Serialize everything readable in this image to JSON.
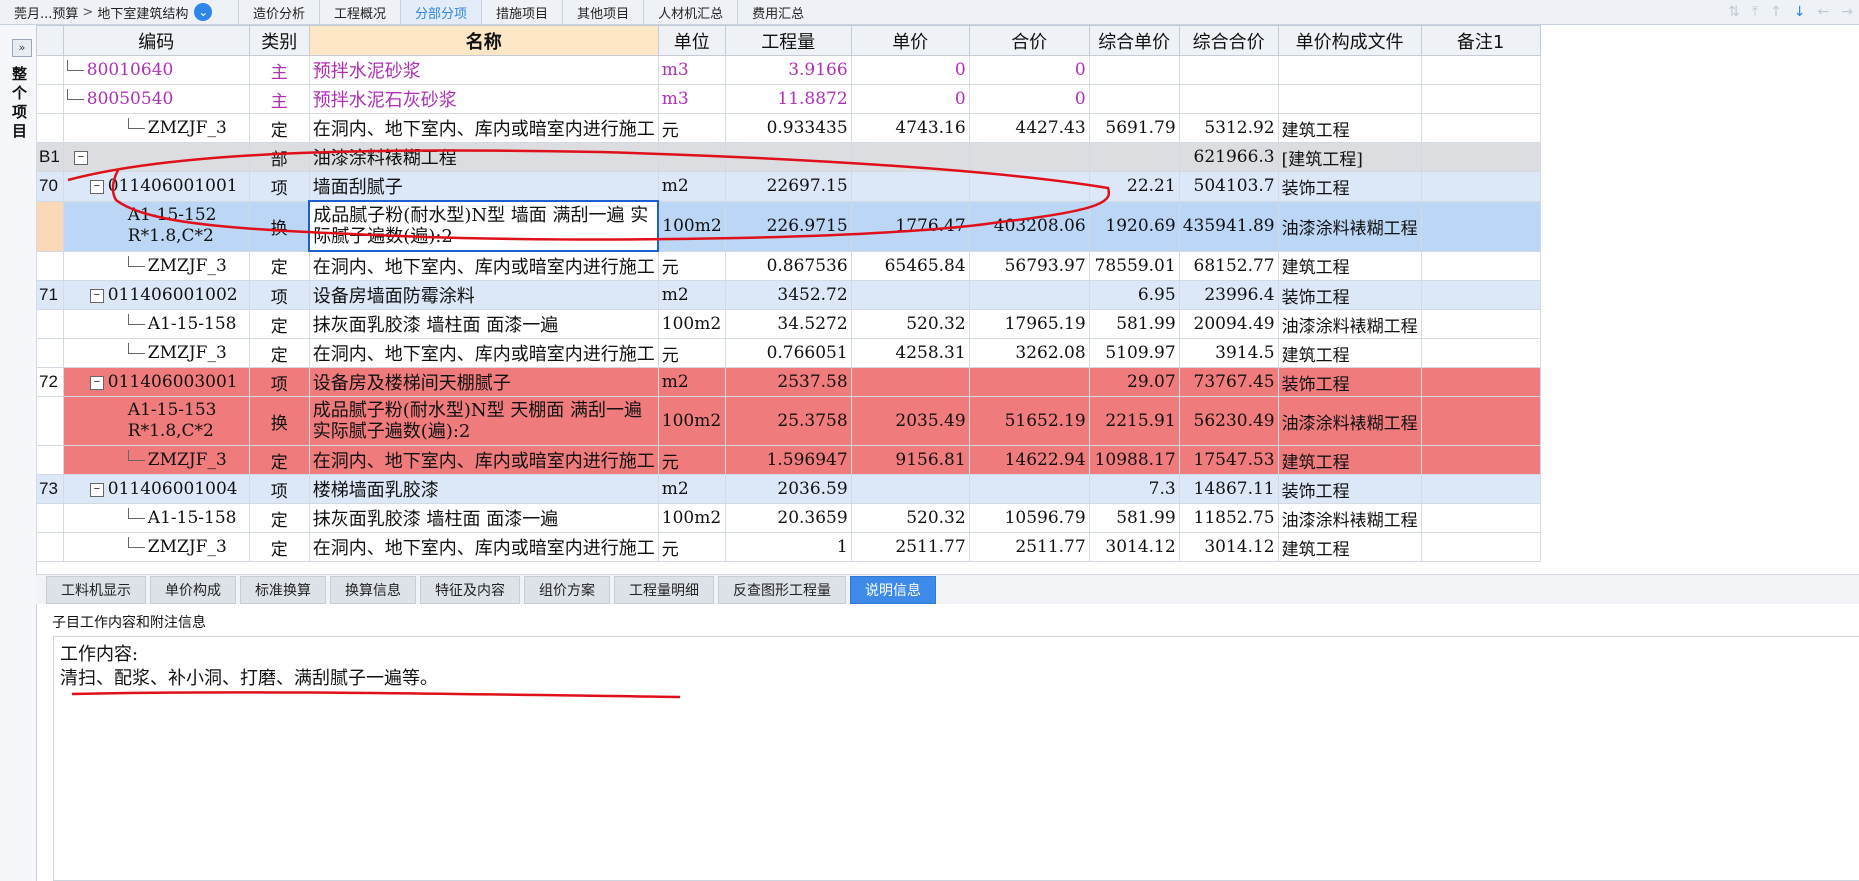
{
  "topbar": {
    "breadcrumb": [
      "莞月...预算",
      "地下室建筑结构"
    ],
    "tabs": [
      "造价分析",
      "工程概况",
      "分部分项",
      "措施项目",
      "其他项目",
      "人材机汇总",
      "费用汇总"
    ],
    "active_tab": "分部分项"
  },
  "left_panel": {
    "expand_icon": "»",
    "label": "整个项目"
  },
  "grid": {
    "headers": [
      "编码",
      "类别",
      "名称",
      "单位",
      "工程量",
      "单价",
      "合价",
      "综合单价",
      "综合合价",
      "单价构成文件",
      "备注1"
    ],
    "rows": [
      {
        "rn": "",
        "code": "80010640",
        "type": "主",
        "name": "预拌水泥砂浆",
        "unit": "m3",
        "qty": "3.9166",
        "price": "0",
        "total": "0",
        "cprice": "",
        "ctotal": "",
        "file": "",
        "note": ""
      },
      {
        "rn": "",
        "code": "80050540",
        "type": "主",
        "name": "预拌水泥石灰砂浆",
        "unit": "m3",
        "qty": "11.8872",
        "price": "0",
        "total": "0",
        "cprice": "",
        "ctotal": "",
        "file": "",
        "note": ""
      },
      {
        "rn": "",
        "code": "ZMZJF_3",
        "type": "定",
        "name": "在洞内、地下室内、库内或暗室内进行施工",
        "unit": "元",
        "qty": "0.933435",
        "price": "4743.16",
        "total": "4427.43",
        "cprice": "5691.79",
        "ctotal": "5312.92",
        "file": "建筑工程",
        "note": ""
      },
      {
        "rn": "B1",
        "code": "",
        "type": "部",
        "name": "油漆涂料裱糊工程",
        "unit": "",
        "qty": "",
        "price": "",
        "total": "",
        "cprice": "",
        "ctotal": "621966.3",
        "file": "[建筑工程]",
        "note": ""
      },
      {
        "rn": "70",
        "code": "011406001001",
        "type": "项",
        "name": "墙面刮腻子",
        "unit": "m2",
        "qty": "22697.15",
        "price": "",
        "total": "",
        "cprice": "22.21",
        "ctotal": "504103.7",
        "file": "装饰工程",
        "note": ""
      },
      {
        "rn": "",
        "code": "A1-15-152 R*1.8,C*2",
        "type": "换",
        "name": "成品腻子粉(耐水型)N型 墙面 满刮一遍 实际腻子遍数(遍):2",
        "unit": "100m2",
        "qty": "226.9715",
        "price": "1776.47",
        "total": "403208.06",
        "cprice": "1920.69",
        "ctotal": "435941.89",
        "file": "油漆涂料裱糊工程",
        "note": ""
      },
      {
        "rn": "",
        "code": "ZMZJF_3",
        "type": "定",
        "name": "在洞内、地下室内、库内或暗室内进行施工",
        "unit": "元",
        "qty": "0.867536",
        "price": "65465.84",
        "total": "56793.97",
        "cprice": "78559.01",
        "ctotal": "68152.77",
        "file": "建筑工程",
        "note": ""
      },
      {
        "rn": "71",
        "code": "011406001002",
        "type": "项",
        "name": "设备房墙面防霉涂料",
        "unit": "m2",
        "qty": "3452.72",
        "price": "",
        "total": "",
        "cprice": "6.95",
        "ctotal": "23996.4",
        "file": "装饰工程",
        "note": ""
      },
      {
        "rn": "",
        "code": "A1-15-158",
        "type": "定",
        "name": "抹灰面乳胶漆 墙柱面 面漆一遍",
        "unit": "100m2",
        "qty": "34.5272",
        "price": "520.32",
        "total": "17965.19",
        "cprice": "581.99",
        "ctotal": "20094.49",
        "file": "油漆涂料裱糊工程",
        "note": ""
      },
      {
        "rn": "",
        "code": "ZMZJF_3",
        "type": "定",
        "name": "在洞内、地下室内、库内或暗室内进行施工",
        "unit": "元",
        "qty": "0.766051",
        "price": "4258.31",
        "total": "3262.08",
        "cprice": "5109.97",
        "ctotal": "3914.5",
        "file": "建筑工程",
        "note": ""
      },
      {
        "rn": "72",
        "code": "011406003001",
        "type": "项",
        "name": "设备房及楼梯间天棚腻子",
        "unit": "m2",
        "qty": "2537.58",
        "price": "",
        "total": "",
        "cprice": "29.07",
        "ctotal": "73767.45",
        "file": "装饰工程",
        "note": ""
      },
      {
        "rn": "",
        "code": "A1-15-153 R*1.8,C*2",
        "type": "换",
        "name": "成品腻子粉(耐水型)N型 天棚面 满刮一遍 实际腻子遍数(遍):2",
        "unit": "100m2",
        "qty": "25.3758",
        "price": "2035.49",
        "total": "51652.19",
        "cprice": "2215.91",
        "ctotal": "56230.49",
        "file": "油漆涂料裱糊工程",
        "note": ""
      },
      {
        "rn": "",
        "code": "ZMZJF_3",
        "type": "定",
        "name": "在洞内、地下室内、库内或暗室内进行施工",
        "unit": "元",
        "qty": "1.596947",
        "price": "9156.81",
        "total": "14622.94",
        "cprice": "10988.17",
        "ctotal": "17547.53",
        "file": "建筑工程",
        "note": ""
      },
      {
        "rn": "73",
        "code": "011406001004",
        "type": "项",
        "name": "楼梯墙面乳胶漆",
        "unit": "m2",
        "qty": "2036.59",
        "price": "",
        "total": "",
        "cprice": "7.3",
        "ctotal": "14867.11",
        "file": "装饰工程",
        "note": ""
      },
      {
        "rn": "",
        "code": "A1-15-158",
        "type": "定",
        "name": "抹灰面乳胶漆 墙柱面 面漆一遍",
        "unit": "100m2",
        "qty": "20.3659",
        "price": "520.32",
        "total": "10596.79",
        "cprice": "581.99",
        "ctotal": "11852.75",
        "file": "油漆涂料裱糊工程",
        "note": ""
      },
      {
        "rn": "",
        "code": "ZMZJF_3",
        "type": "定",
        "name": "在洞内、地下室内、库内或暗室内进行施工",
        "unit": "元",
        "qty": "1",
        "price": "2511.77",
        "total": "2511.77",
        "cprice": "3014.12",
        "ctotal": "3014.12",
        "file": "建筑工程",
        "note": ""
      }
    ]
  },
  "bottom_tabs": {
    "tabs": [
      "工料机显示",
      "单价构成",
      "标准换算",
      "换算信息",
      "特征及内容",
      "组价方案",
      "工程量明细",
      "反查图形工程量",
      "说明信息"
    ],
    "active": "说明信息"
  },
  "info": {
    "section_title": "子目工作内容和附注信息",
    "line1": "工作内容:",
    "line2": "清扫、配浆、补小洞、打磨、满刮腻子一遍等。"
  },
  "colors": {
    "accent": "#2f86e6",
    "row_red": "#f07b7d",
    "row_blue": "#dce8f7",
    "row_grey": "#dcdde0",
    "selected": "#bcd6f6",
    "purple_text": "#b12fb6",
    "annotation": "#e0101a"
  }
}
